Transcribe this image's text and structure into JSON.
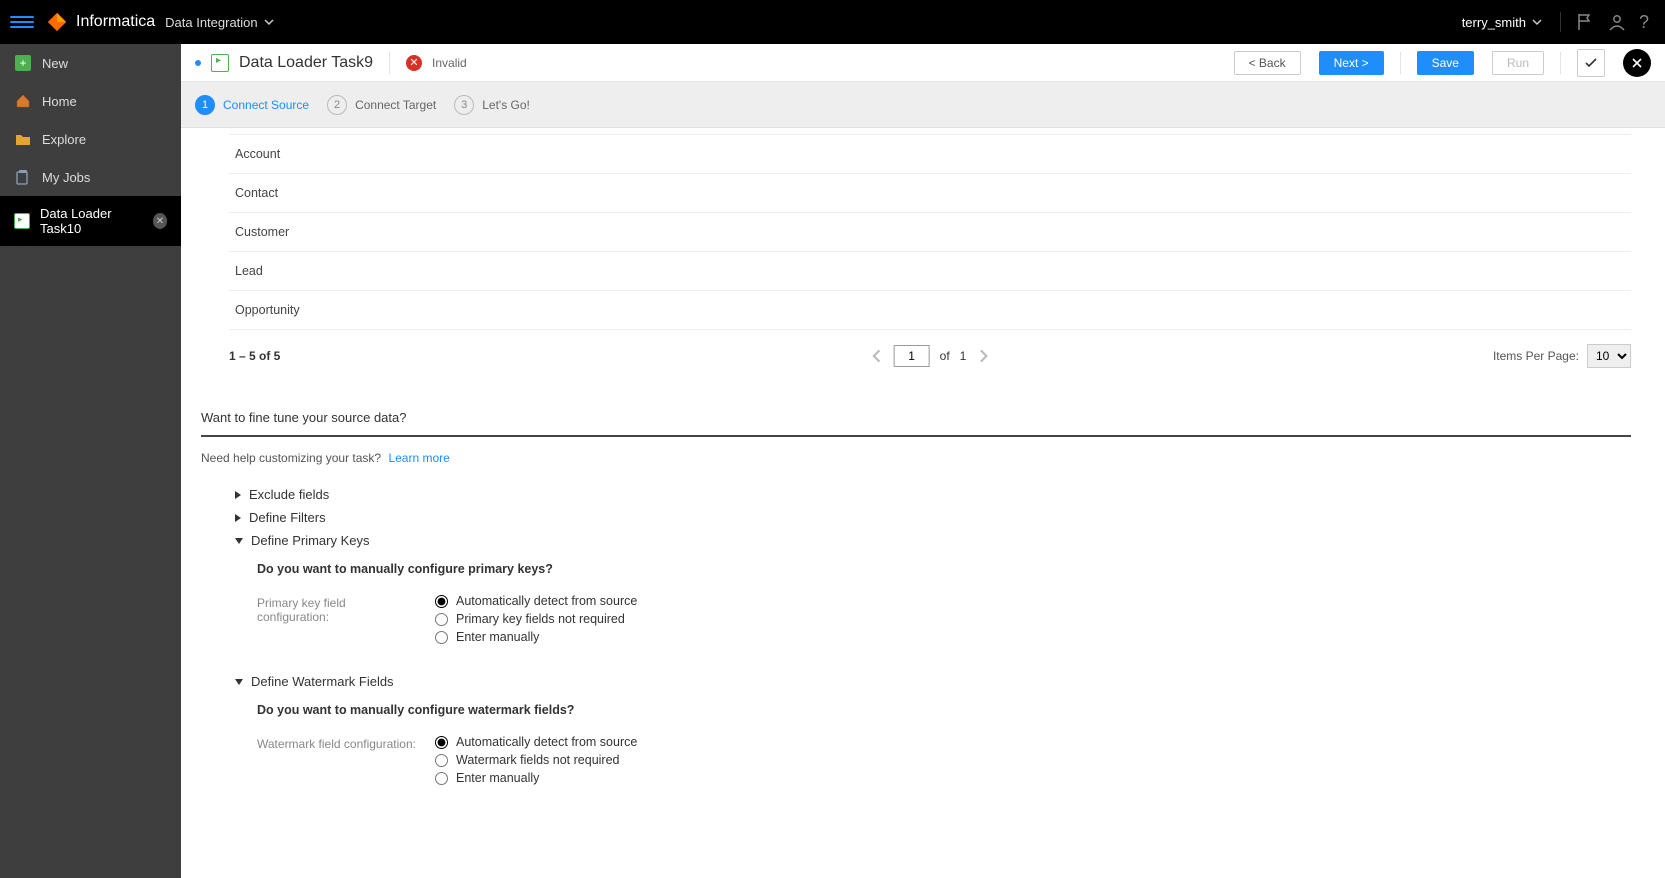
{
  "topbar": {
    "brand": "Informatica",
    "product": "Data Integration",
    "user": "terry_smith"
  },
  "sidebar": {
    "items": [
      {
        "id": "new",
        "label": "New"
      },
      {
        "id": "home",
        "label": "Home"
      },
      {
        "id": "explore",
        "label": "Explore"
      },
      {
        "id": "myjobs",
        "label": "My Jobs"
      },
      {
        "id": "task10",
        "label": "Data Loader Task10",
        "active": true,
        "closable": true
      }
    ]
  },
  "header": {
    "title": "Data Loader Task9",
    "status_label": "Invalid",
    "buttons": {
      "back": "< Back",
      "next": "Next >",
      "save": "Save",
      "run": "Run"
    }
  },
  "wizard": {
    "steps": [
      {
        "num": "1",
        "label": "Connect Source",
        "active": true
      },
      {
        "num": "2",
        "label": "Connect Target"
      },
      {
        "num": "3",
        "label": "Let's Go!"
      }
    ]
  },
  "objects": {
    "rows": [
      "Account",
      "Contact",
      "Customer",
      "Lead",
      "Opportunity"
    ],
    "pager": {
      "range": "1 – 5 of 5",
      "page": "1",
      "of_label": "of",
      "total_pages": "1",
      "items_per_page_label": "Items Per Page:",
      "items_per_page": "10"
    }
  },
  "finetune": {
    "title": "Want to fine tune your source data?",
    "help_text": "Need help customizing your task?",
    "learn_more": "Learn more",
    "sections": {
      "exclude_fields": "Exclude fields",
      "define_filters": "Define Filters",
      "define_pk": "Define Primary Keys",
      "define_wm": "Define Watermark Fields"
    },
    "pk": {
      "question": "Do you want to manually configure primary keys?",
      "field_label": "Primary key field configuration:",
      "options": [
        "Automatically detect from source",
        "Primary key fields not required",
        "Enter manually"
      ],
      "selected": 0
    },
    "wm": {
      "question": "Do you want to manually configure watermark fields?",
      "field_label": "Watermark field configuration:",
      "options": [
        "Automatically detect from source",
        "Watermark fields not required",
        "Enter manually"
      ],
      "selected": 0
    }
  }
}
